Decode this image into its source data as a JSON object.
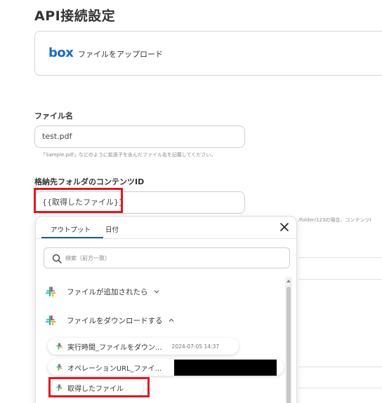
{
  "page": {
    "title": "API接続設定"
  },
  "app_card": {
    "logo_text": "box",
    "action_label": "ファイルをアップロード"
  },
  "file_name": {
    "label": "ファイル名",
    "value": "test.pdf",
    "hint": "「Sample.pdf」などのように拡張子を含んだファイル名を記載してください。"
  },
  "folder_id": {
    "label": "格納先フォルダのコンテンツID",
    "value": "{{取得したファイル}}",
    "hint_partial": "/folder/123の場合、コンテンツI"
  },
  "popup": {
    "tabs": [
      {
        "label": "アウトプット",
        "active": true
      },
      {
        "label": "日付",
        "active": false
      }
    ],
    "search_placeholder": "検索（前方一致）",
    "groups": [
      {
        "label": "ファイルが追加されたら",
        "expanded": false
      },
      {
        "label": "ファイルをダウンロードする",
        "expanded": true
      }
    ],
    "items": [
      {
        "label": "実行時間_ファイルをダウン...",
        "meta": "2024-07-05 14:37"
      },
      {
        "label": "オペレーションURL_ファイ...",
        "meta": ""
      },
      {
        "label": "取得したファイル",
        "meta": ""
      }
    ]
  },
  "colors": {
    "highlight": "#e0181f",
    "box_brand": "#1a6bc4",
    "tab_active": "#1e5f8c"
  },
  "icons": [
    "box-logo",
    "close-icon",
    "search-icon",
    "slack-icon",
    "chevron-down-icon",
    "chevron-up-icon"
  ]
}
